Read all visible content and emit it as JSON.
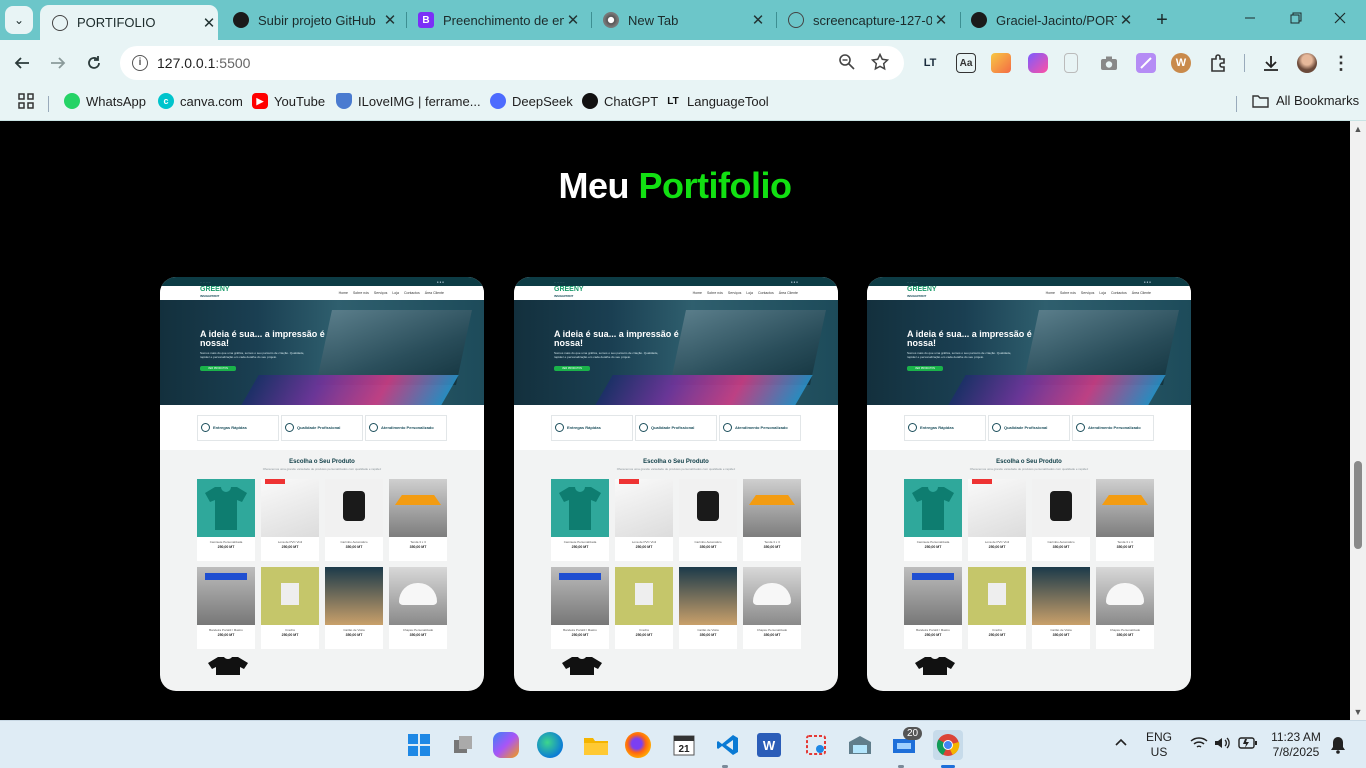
{
  "browser": {
    "tabs": [
      {
        "title": "PORTIFOLIO",
        "icon": "globe-icon",
        "active": true
      },
      {
        "title": "Subir projeto GitHub",
        "icon": "chatgpt-icon"
      },
      {
        "title": "Preenchimento de em",
        "icon": "bootstrap-icon"
      },
      {
        "title": "New Tab",
        "icon": "chrome-icon"
      },
      {
        "title": "screencapture-127-0",
        "icon": "globe-icon"
      },
      {
        "title": "Graciel-Jacinto/PORT",
        "icon": "github-icon"
      }
    ],
    "new_tab": "+",
    "tab_search": "⌄",
    "close_glyph": "✕",
    "url": "127.0.0.1:5500",
    "url_host": "127.0.0.1",
    "url_port": ":5500",
    "bookmarks": [
      {
        "label": "WhatsApp",
        "color": "#25d366"
      },
      {
        "label": "canva.com",
        "color": "#00c4cc"
      },
      {
        "label": "YouTube",
        "color": "#ff0000"
      },
      {
        "label": "ILoveIMG | ferrame...",
        "color": "#4a7bd0"
      },
      {
        "label": "DeepSeek",
        "color": "#4d6bfe"
      },
      {
        "label": "ChatGPT",
        "color": "#111111"
      },
      {
        "label": "LanguageTool",
        "color": "#1a1a1a"
      }
    ],
    "all_bookmarks": "All Bookmarks"
  },
  "page": {
    "heading_main": "Meu",
    "heading_highlight": "Portifolio",
    "accent": "#12e012"
  },
  "mockup": {
    "hero_title": "A ideia é sua... a impressão é nossa!",
    "hero_desc": "Somos mais do que uma gráfica, somos o seu parceiro de criação. Qualidade, rapidez e personalização em cada detalhe do seu projeto.",
    "hero_button": "VER PRODUTOS",
    "logo_main": "GREENY",
    "logo_sub": "INSIGHPRINT",
    "menu": [
      "Home",
      "Sobre nós",
      "Serviços",
      "Loja",
      "Contactos",
      "Área Cliente"
    ],
    "features": [
      "Entregas Rápidas",
      "Qualidade Profissional",
      "Atendimento Personalizado"
    ],
    "section_title": "Escolha o Seu Produto",
    "section_sub": "Oferecemos uma grande variedade de produtos personalizados com qualidade e rapidez",
    "products": [
      {
        "name": "Camisete Personalizada",
        "price": "250,00 MT"
      },
      {
        "name": "Lona de PVC Vinil",
        "price": "250,00 MT"
      },
      {
        "name": "Carimbo Automático",
        "price": "350,00 MT"
      },
      {
        "name": "Tenda 3 x 3",
        "price": "350,00 MT"
      },
      {
        "name": "Bandeira Portátil / Mastro",
        "price": "250,00 MT"
      },
      {
        "name": "Crachá",
        "price": "250,00 MT"
      },
      {
        "name": "Cartão de Visita",
        "price": "350,00 MT"
      },
      {
        "name": "Chapéu Personalizado",
        "price": "350,00 MT"
      }
    ]
  },
  "taskbar": {
    "lang": "ENG",
    "region": "US",
    "time": "11:23 AM",
    "date": "7/8/2025",
    "badge": "20"
  }
}
